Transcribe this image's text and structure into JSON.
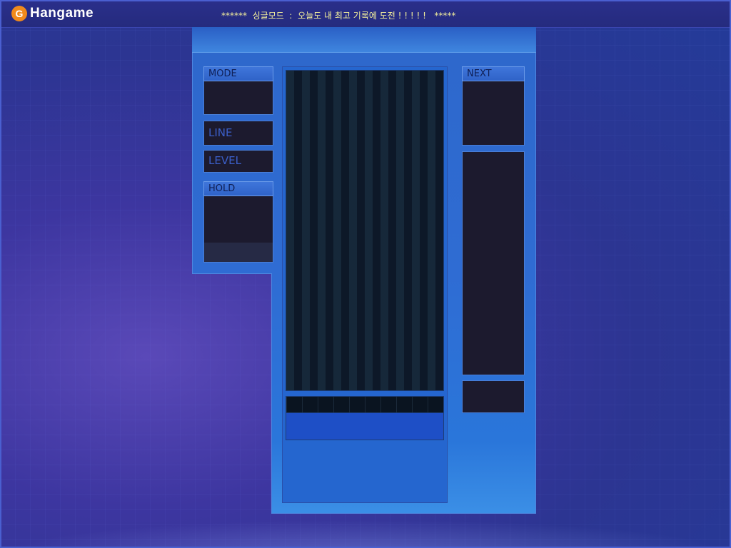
{
  "topbar": {
    "logo_text": "Hangame",
    "logo_mark": "G",
    "notice": "******  싱글모드  :  오늘도 내 최고 기록에 도전 ! ! ! ! !   *****"
  },
  "left_panel": {
    "mode_label": "MODE",
    "line_label": "LINE",
    "level_label": "LEVEL",
    "hold_label": "HOLD"
  },
  "right_panel": {
    "next_label": "NEXT"
  },
  "colors": {
    "accent": "#3f76da",
    "box_bg": "#1c1a2e",
    "playfield_bg": "#0d1828",
    "notice_text": "#f3ef9c"
  }
}
